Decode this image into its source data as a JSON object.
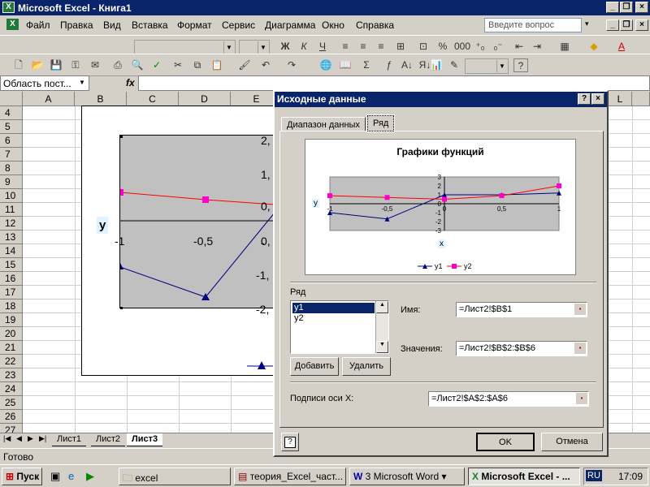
{
  "app": {
    "title": "Microsoft Excel - Книга1"
  },
  "menu": {
    "items": [
      "Файл",
      "Правка",
      "Вид",
      "Вставка",
      "Формат",
      "Сервис",
      "Диаграмма",
      "Окно",
      "Справка"
    ],
    "ask_placeholder": "Введите вопрос"
  },
  "formula_bar": {
    "name_box": "Область пост...",
    "fx": "fx",
    "value": ""
  },
  "grid": {
    "columns": [
      "A",
      "B",
      "C",
      "D",
      "E",
      "L"
    ],
    "rows": [
      "4",
      "5",
      "6",
      "7",
      "8",
      "9",
      "10",
      "11",
      "12",
      "13",
      "14",
      "15",
      "16",
      "17",
      "18",
      "19",
      "20",
      "21",
      "22",
      "23",
      "24",
      "25",
      "26",
      "27"
    ]
  },
  "embedded_chart": {
    "ytitle": "у",
    "yticks": [
      "2,",
      "1,",
      "0,",
      "-",
      "-1,",
      "-2,"
    ],
    "xticks": [
      "-1",
      "-0,5",
      "0,"
    ]
  },
  "sheets": {
    "tabs": [
      "Лист1",
      "Лист2",
      "Лист3"
    ],
    "active": "Лист3"
  },
  "status": {
    "text": "Готово"
  },
  "taskbar": {
    "start": "Пуск",
    "buttons": [
      "excel",
      "теория_Excel_част...",
      "3 Microsoft Word",
      "Microsoft Excel - ..."
    ],
    "lang": "RU",
    "clock": "17:09"
  },
  "dialog": {
    "title": "Исходные данные",
    "help": "?",
    "close": "×",
    "tabs": [
      "Диапазон данных",
      "Ряд"
    ],
    "series_label": "Ряд",
    "series": [
      "y1",
      "y2"
    ],
    "add_button": "Добавить",
    "delete_button": "Удалить",
    "name_label": "Имя:",
    "name_value": "=Лист2!$B$1",
    "values_label": "Значения:",
    "values_value": "=Лист2!$B$2:$B$6",
    "xlabels_label": "Подписи оси X:",
    "xlabels_value": "=Лист2!$A$2:$A$6",
    "ok": "OK",
    "cancel": "Отмена"
  },
  "chart_data": {
    "type": "line",
    "title": "Графики функций",
    "xlabel": "x",
    "ylabel": "у",
    "x": [
      -1,
      -0.5,
      0,
      0.5,
      1
    ],
    "xticks": [
      "-1",
      "-0,5",
      "0",
      "0,5",
      "1"
    ],
    "yticks": [
      "3",
      "2",
      "1",
      "0",
      "-1",
      "-2",
      "-3"
    ],
    "ylim": [
      -3,
      3
    ],
    "series": [
      {
        "name": "y1",
        "values": [
          -1,
          -1.7,
          1,
          1,
          1.2
        ],
        "color": "#000080",
        "marker": "triangle"
      },
      {
        "name": "y2",
        "values": [
          0.9,
          0.7,
          0.5,
          0.9,
          2
        ],
        "color": "#ff0000",
        "marker": "square"
      }
    ],
    "legend": "bottom",
    "plot_bg": "#c0c0c0"
  }
}
